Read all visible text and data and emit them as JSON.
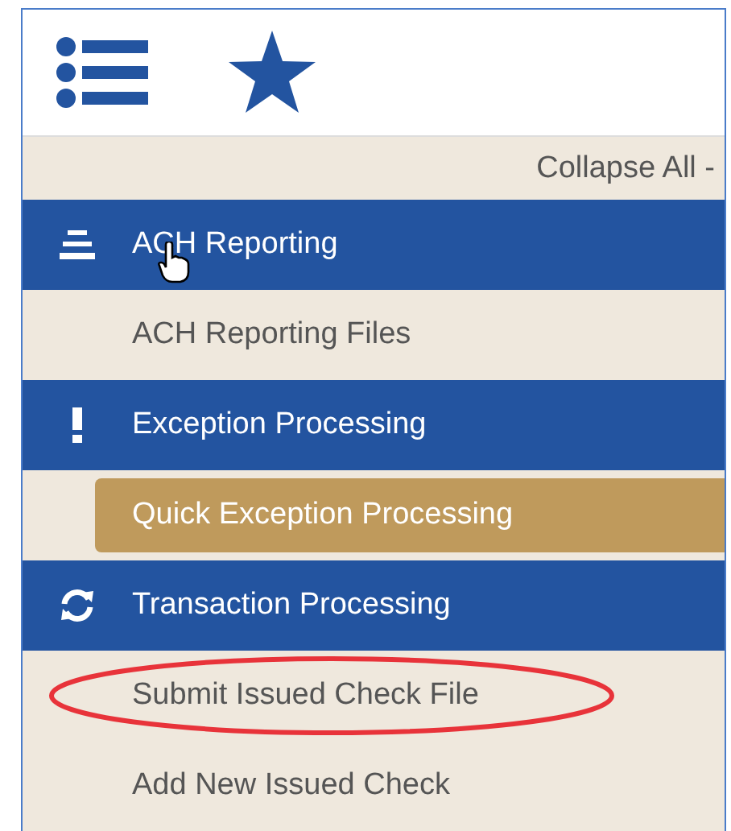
{
  "collapse_all": "Collapse All -",
  "sections": [
    {
      "label": "ACH Reporting",
      "hovered": true,
      "children": [
        {
          "label": "ACH Reporting Files",
          "selected": false,
          "circled": false
        }
      ]
    },
    {
      "label": "Exception Processing",
      "hovered": false,
      "children": [
        {
          "label": "Quick Exception Processing",
          "selected": true,
          "circled": false
        }
      ]
    },
    {
      "label": "Transaction Processing",
      "hovered": false,
      "children": [
        {
          "label": "Submit Issued Check File",
          "selected": false,
          "circled": true
        },
        {
          "label": "Add New Issued Check",
          "selected": false,
          "circled": false
        }
      ]
    }
  ]
}
